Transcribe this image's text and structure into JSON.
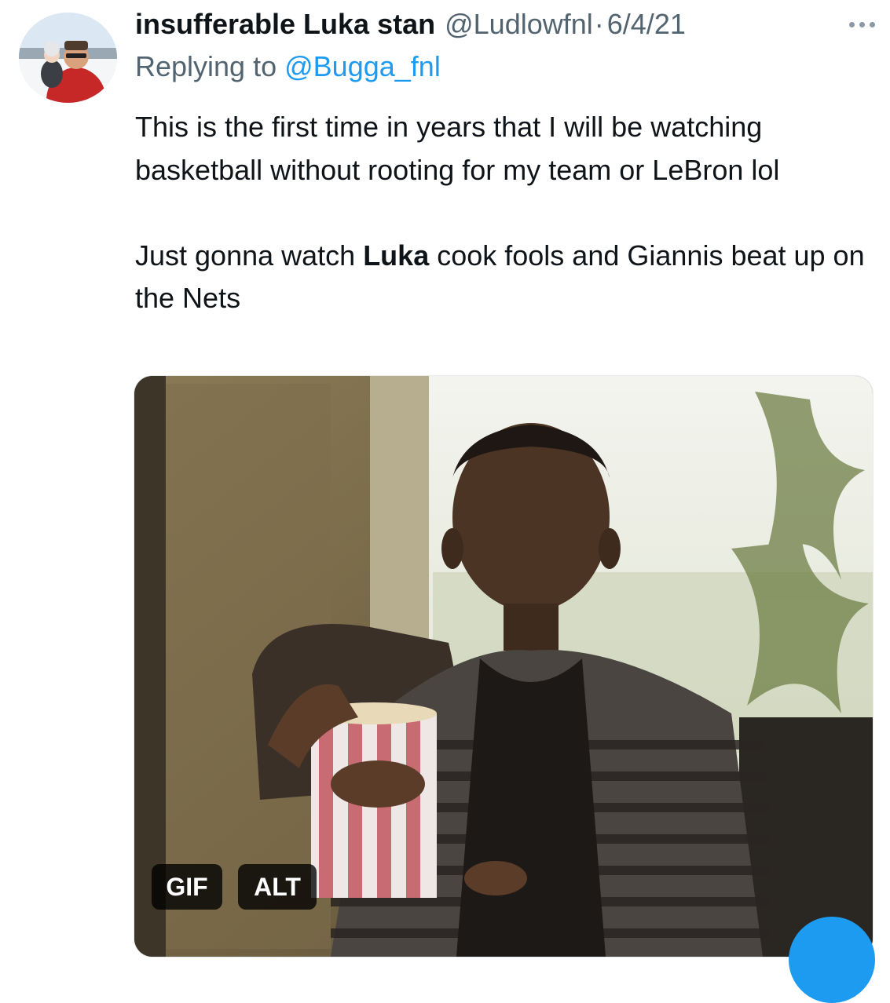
{
  "tweet": {
    "display_name": "insufferable Luka stan",
    "handle": "@Ludlowfnl",
    "separator": "·",
    "date": "6/4/21",
    "reply_prefix": "Replying to",
    "reply_to": "@Bugga_fnl",
    "paragraph1": "This is the first time in years that I will be watching basketball without rooting for my team or LeBron lol",
    "p2_before": "Just gonna watch ",
    "p2_bold": "Luka",
    "p2_after": " cook fools and Giannis beat up on the Nets"
  },
  "media": {
    "gif_label": "GIF",
    "alt_label": "ALT"
  },
  "icons": {
    "more": "more-horizontal-icon",
    "compose": "compose-fab"
  },
  "colors": {
    "link": "#1d9bf0",
    "secondary_text": "#536471",
    "primary_text": "#0f1419"
  }
}
